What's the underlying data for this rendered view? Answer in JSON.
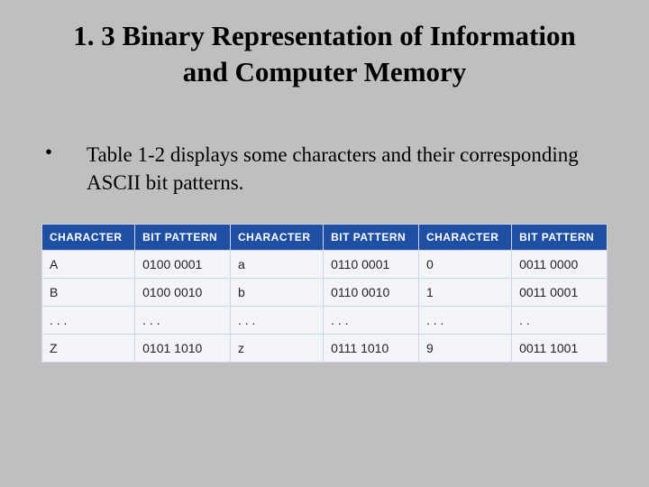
{
  "title_line1": "1. 3  Binary Representation of Information",
  "title_line2": "and Computer Memory",
  "bullet_symbol": "•",
  "bullet_text": "Table 1-2 displays some characters and their corresponding ASCII bit patterns.",
  "chart_data": {
    "type": "table",
    "title": "ASCII bit patterns",
    "headers": [
      "CHARACTER",
      "BIT PATTERN",
      "CHARACTER",
      "BIT PATTERN",
      "CHARACTER",
      "BIT PATTERN"
    ],
    "rows": [
      [
        "A",
        "0100 0001",
        "a",
        "0110 0001",
        "0",
        "0011 0000"
      ],
      [
        "B",
        "0100 0010",
        "b",
        "0110 0010",
        "1",
        "0011 0001"
      ],
      [
        ". . .",
        ". . .",
        ". . .",
        ". . .",
        ". . .",
        ". ."
      ],
      [
        "Z",
        "0101 1010",
        "z",
        "0111 1010",
        "9",
        "0011 1001"
      ]
    ]
  }
}
